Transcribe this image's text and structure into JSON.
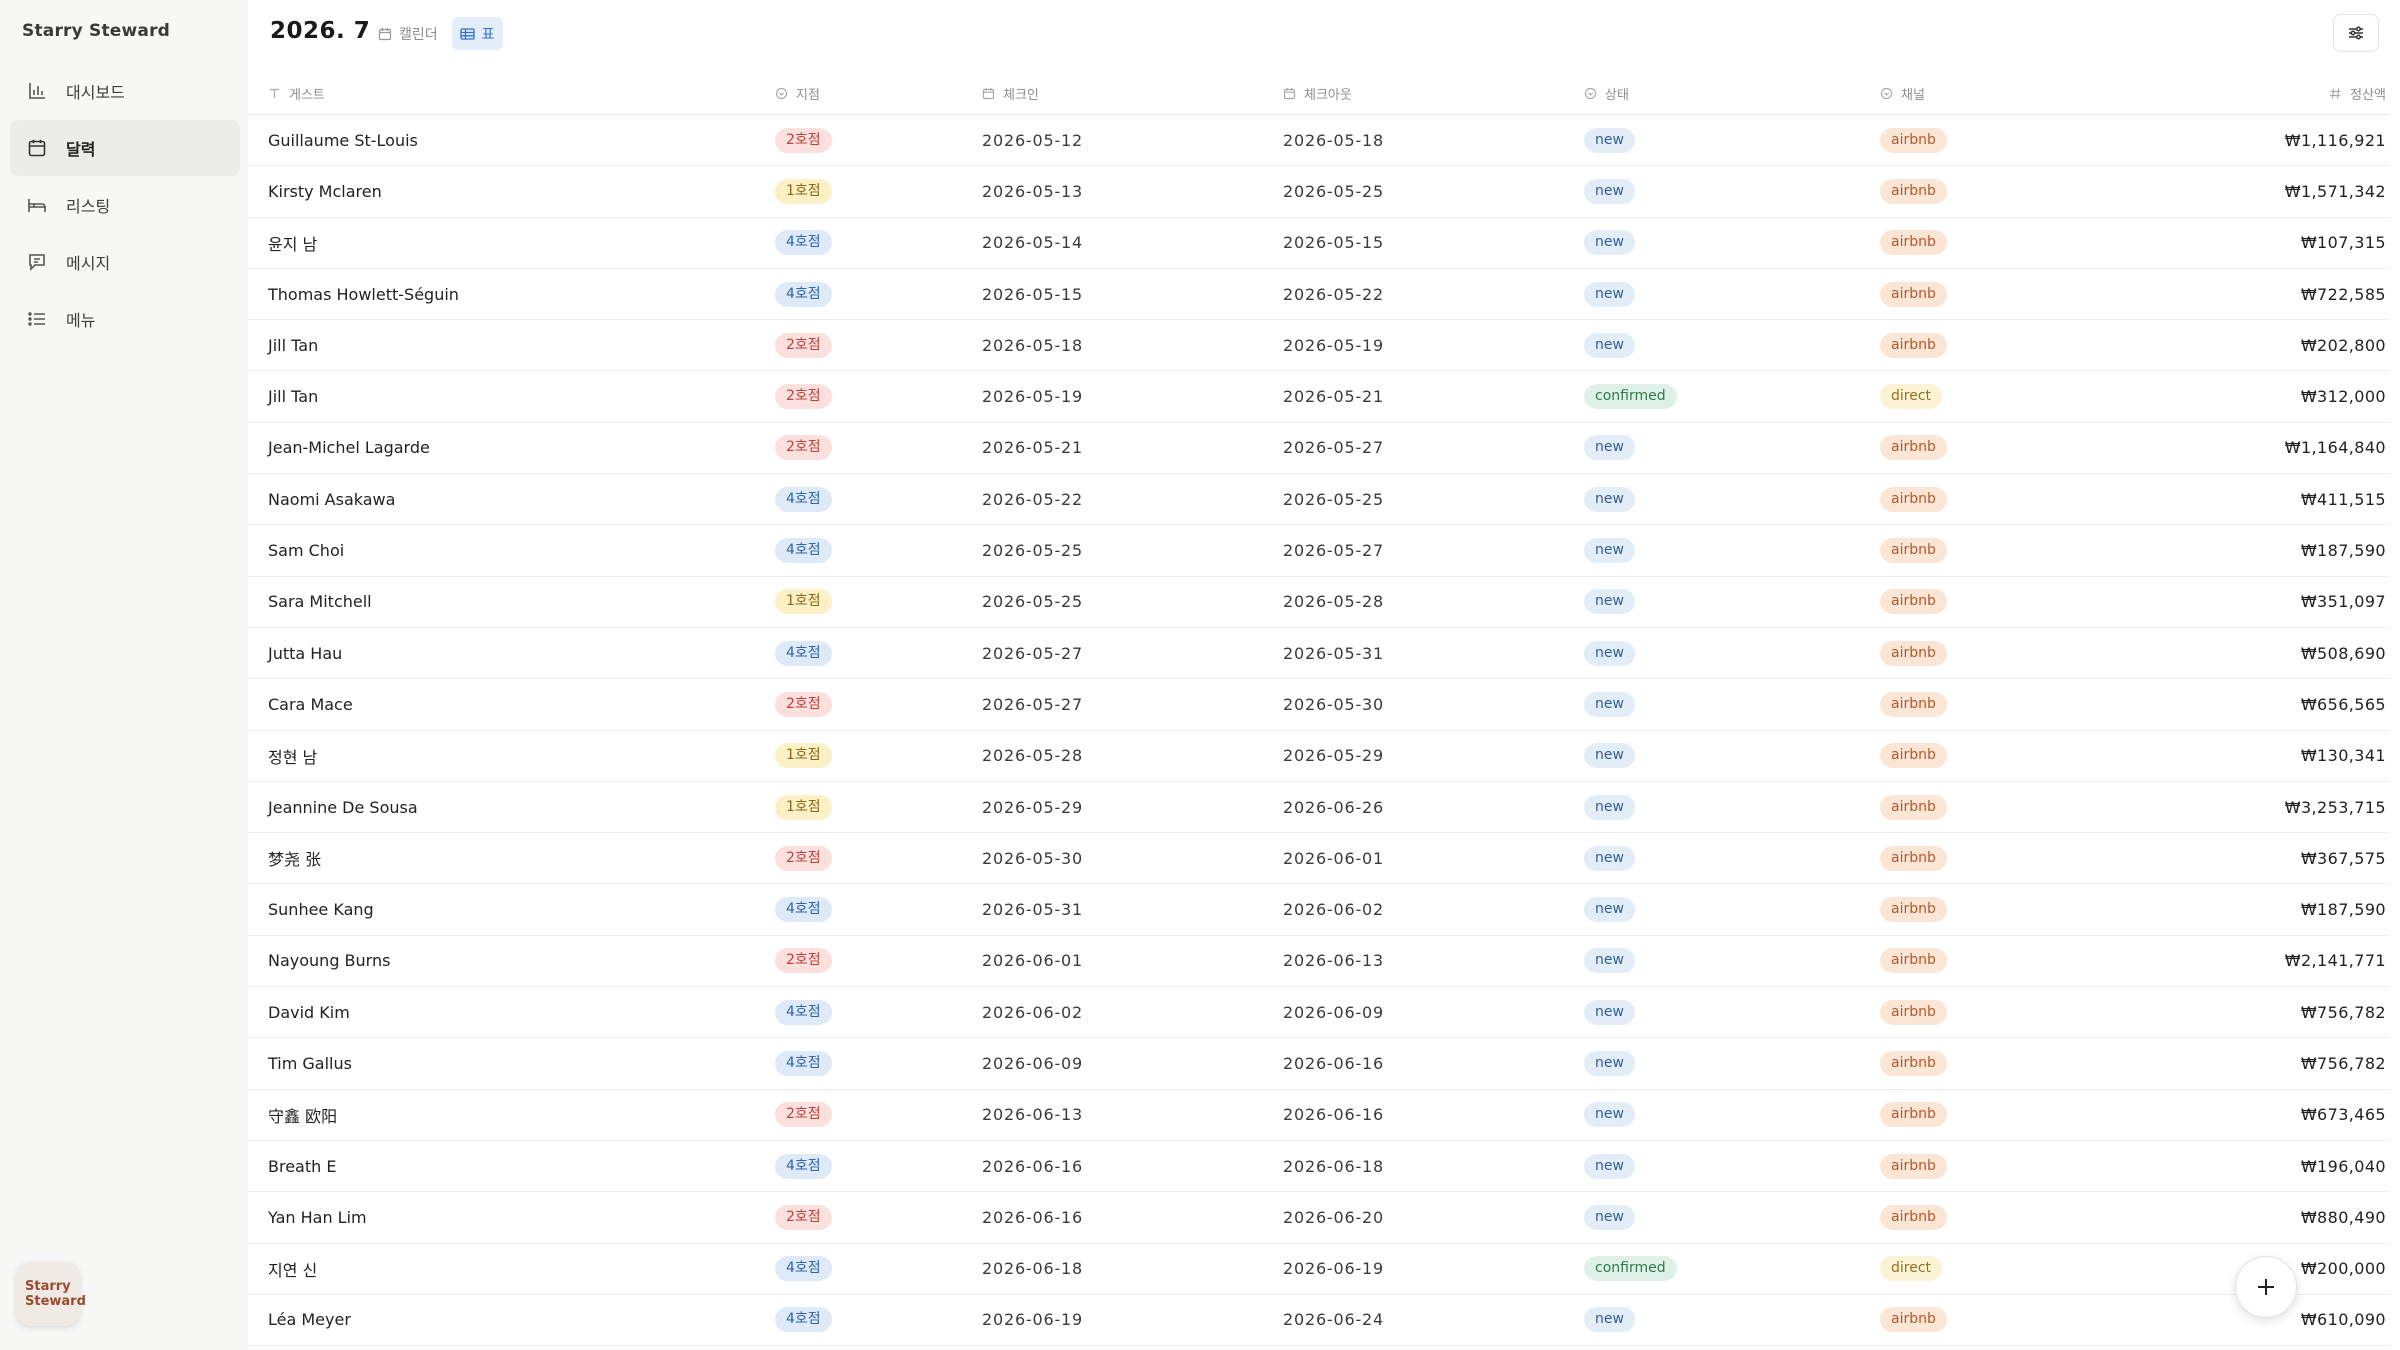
{
  "app": {
    "brand": "Starry Steward",
    "logo_line1": "Starry",
    "logo_line2": "Steward"
  },
  "sidebar": {
    "items": [
      {
        "label": "대시보드",
        "icon": "bar-chart-icon",
        "active": false
      },
      {
        "label": "달력",
        "icon": "calendar-icon",
        "active": true
      },
      {
        "label": "리스팅",
        "icon": "bed-icon",
        "active": false
      },
      {
        "label": "메시지",
        "icon": "message-icon",
        "active": false
      },
      {
        "label": "메뉴",
        "icon": "list-icon",
        "active": false
      }
    ]
  },
  "header": {
    "month": "2026. 7",
    "view_calendar": "캘린더",
    "view_table": "표",
    "active_view": "표"
  },
  "table": {
    "headers": {
      "guest": "게스트",
      "branch": "지점",
      "checkin": "체크인",
      "checkout": "체크아웃",
      "status": "상태",
      "channel": "채널",
      "amount": "정산액"
    },
    "rows": [
      {
        "guest": "Guillaume St-Louis",
        "branch": "2호점",
        "checkin": "2026-05-12",
        "checkout": "2026-05-18",
        "status": "new",
        "channel": "airbnb",
        "amount": "₩1,116,921"
      },
      {
        "guest": "Kirsty Mclaren",
        "branch": "1호점",
        "checkin": "2026-05-13",
        "checkout": "2026-05-25",
        "status": "new",
        "channel": "airbnb",
        "amount": "₩1,571,342"
      },
      {
        "guest": "윤지 남",
        "branch": "4호점",
        "checkin": "2026-05-14",
        "checkout": "2026-05-15",
        "status": "new",
        "channel": "airbnb",
        "amount": "₩107,315"
      },
      {
        "guest": "Thomas Howlett-Séguin",
        "branch": "4호점",
        "checkin": "2026-05-15",
        "checkout": "2026-05-22",
        "status": "new",
        "channel": "airbnb",
        "amount": "₩722,585"
      },
      {
        "guest": "Jill Tan",
        "branch": "2호점",
        "checkin": "2026-05-18",
        "checkout": "2026-05-19",
        "status": "new",
        "channel": "airbnb",
        "amount": "₩202,800"
      },
      {
        "guest": "Jill Tan",
        "branch": "2호점",
        "checkin": "2026-05-19",
        "checkout": "2026-05-21",
        "status": "confirmed",
        "channel": "direct",
        "amount": "₩312,000"
      },
      {
        "guest": "Jean-Michel Lagarde",
        "branch": "2호점",
        "checkin": "2026-05-21",
        "checkout": "2026-05-27",
        "status": "new",
        "channel": "airbnb",
        "amount": "₩1,164,840"
      },
      {
        "guest": "Naomi Asakawa",
        "branch": "4호점",
        "checkin": "2026-05-22",
        "checkout": "2026-05-25",
        "status": "new",
        "channel": "airbnb",
        "amount": "₩411,515"
      },
      {
        "guest": "Sam Choi",
        "branch": "4호점",
        "checkin": "2026-05-25",
        "checkout": "2026-05-27",
        "status": "new",
        "channel": "airbnb",
        "amount": "₩187,590"
      },
      {
        "guest": "Sara Mitchell",
        "branch": "1호점",
        "checkin": "2026-05-25",
        "checkout": "2026-05-28",
        "status": "new",
        "channel": "airbnb",
        "amount": "₩351,097"
      },
      {
        "guest": "Jutta Hau",
        "branch": "4호점",
        "checkin": "2026-05-27",
        "checkout": "2026-05-31",
        "status": "new",
        "channel": "airbnb",
        "amount": "₩508,690"
      },
      {
        "guest": "Cara Mace",
        "branch": "2호점",
        "checkin": "2026-05-27",
        "checkout": "2026-05-30",
        "status": "new",
        "channel": "airbnb",
        "amount": "₩656,565"
      },
      {
        "guest": "정현 남",
        "branch": "1호점",
        "checkin": "2026-05-28",
        "checkout": "2026-05-29",
        "status": "new",
        "channel": "airbnb",
        "amount": "₩130,341"
      },
      {
        "guest": "Jeannine De Sousa",
        "branch": "1호점",
        "checkin": "2026-05-29",
        "checkout": "2026-06-26",
        "status": "new",
        "channel": "airbnb",
        "amount": "₩3,253,715"
      },
      {
        "guest": "梦尧 张",
        "branch": "2호점",
        "checkin": "2026-05-30",
        "checkout": "2026-06-01",
        "status": "new",
        "channel": "airbnb",
        "amount": "₩367,575"
      },
      {
        "guest": "Sunhee Kang",
        "branch": "4호점",
        "checkin": "2026-05-31",
        "checkout": "2026-06-02",
        "status": "new",
        "channel": "airbnb",
        "amount": "₩187,590"
      },
      {
        "guest": "Nayoung Burns",
        "branch": "2호점",
        "checkin": "2026-06-01",
        "checkout": "2026-06-13",
        "status": "new",
        "channel": "airbnb",
        "amount": "₩2,141,771"
      },
      {
        "guest": "David Kim",
        "branch": "4호점",
        "checkin": "2026-06-02",
        "checkout": "2026-06-09",
        "status": "new",
        "channel": "airbnb",
        "amount": "₩756,782"
      },
      {
        "guest": "Tim Gallus",
        "branch": "4호점",
        "checkin": "2026-06-09",
        "checkout": "2026-06-16",
        "status": "new",
        "channel": "airbnb",
        "amount": "₩756,782"
      },
      {
        "guest": "守鑫 欧阳",
        "branch": "2호점",
        "checkin": "2026-06-13",
        "checkout": "2026-06-16",
        "status": "new",
        "channel": "airbnb",
        "amount": "₩673,465"
      },
      {
        "guest": "Breath E",
        "branch": "4호점",
        "checkin": "2026-06-16",
        "checkout": "2026-06-18",
        "status": "new",
        "channel": "airbnb",
        "amount": "₩196,040"
      },
      {
        "guest": "Yan Han Lim",
        "branch": "2호점",
        "checkin": "2026-06-16",
        "checkout": "2026-06-20",
        "status": "new",
        "channel": "airbnb",
        "amount": "₩880,490"
      },
      {
        "guest": "지연 신",
        "branch": "4호점",
        "checkin": "2026-06-18",
        "checkout": "2026-06-19",
        "status": "confirmed",
        "channel": "direct",
        "amount": "₩200,000"
      },
      {
        "guest": "Léa Meyer",
        "branch": "4호점",
        "checkin": "2026-06-19",
        "checkout": "2026-06-24",
        "status": "new",
        "channel": "airbnb",
        "amount": "₩610,090"
      }
    ]
  },
  "colors": {
    "branch_1": {
      "bg": "#fbf0c6",
      "fg": "#8a6a10"
    },
    "branch_2": {
      "bg": "#fbe0dd",
      "fg": "#c0413a"
    },
    "branch_4": {
      "bg": "#dfeaf8",
      "fg": "#2e64b0"
    },
    "status_new": {
      "bg": "#e3edf8",
      "fg": "#2f5f99"
    },
    "status_confirmed": {
      "bg": "#dff1e6",
      "fg": "#2f7a4c"
    },
    "channel_airbnb": {
      "bg": "#fbe6d6",
      "fg": "#b5582a"
    },
    "channel_direct": {
      "bg": "#fbf3d3",
      "fg": "#8f7420"
    }
  }
}
